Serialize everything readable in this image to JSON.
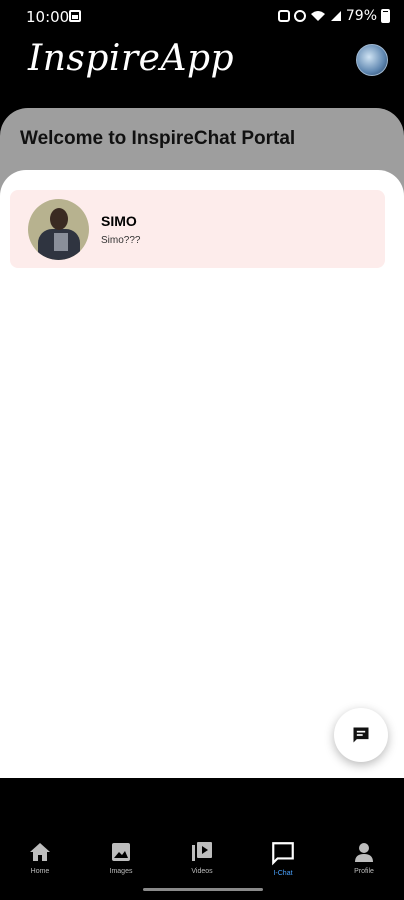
{
  "status": {
    "time": "10:00",
    "battery": "79%",
    "icons": [
      "photo-icon",
      "lock-icon",
      "alarm-icon",
      "wifi-icon",
      "signal-icon",
      "battery-icon"
    ]
  },
  "header": {
    "app_name": "InspireApp",
    "avatar_icon": "profile-avatar"
  },
  "welcome": {
    "title": "Welcome to InspireChat Portal"
  },
  "chats": [
    {
      "name": "SIMO",
      "preview": "Simo???"
    }
  ],
  "fab": {
    "icon": "chat-icon"
  },
  "nav": {
    "items": [
      {
        "label": "Home",
        "icon": "home-icon",
        "active": false
      },
      {
        "label": "Images",
        "icon": "image-icon",
        "active": false
      },
      {
        "label": "Videos",
        "icon": "video-icon",
        "active": false
      },
      {
        "label": "I-Chat",
        "icon": "chat-icon",
        "active": true
      },
      {
        "label": "Profile",
        "icon": "person-icon",
        "active": false
      }
    ]
  },
  "colors": {
    "background": "#000000",
    "panel": "#9e9e9e",
    "chat_item": "#fdeceb",
    "active_nav": "#4aa3ff"
  }
}
